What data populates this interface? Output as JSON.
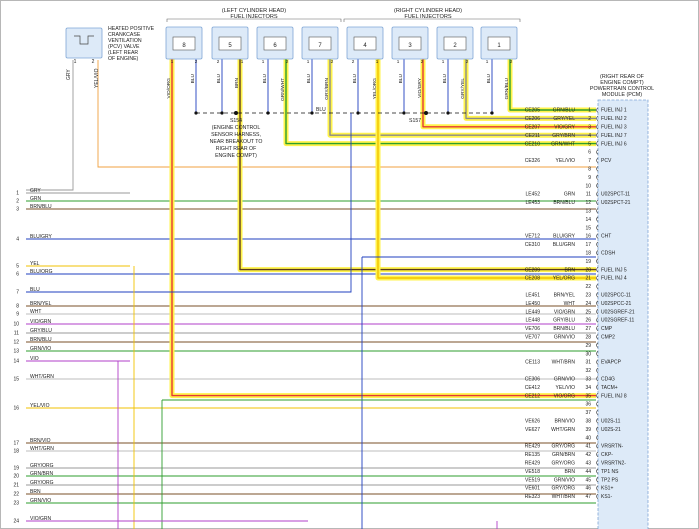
{
  "groups": {
    "left_head": [
      "(LEFT CYLINDER HEAD)",
      "FUEL INJECTORS"
    ],
    "right_head": [
      "(RIGHT CYLINDER HEAD)",
      "FUEL INJECTORS"
    ]
  },
  "pcv": {
    "label": [
      "HEATED POSITIVE",
      "CRANKCASE",
      "VENTILATION",
      "(PCV) VALVE",
      "(LEFT REAR",
      "OF ENGINE)"
    ],
    "pins": [
      "1",
      "2"
    ],
    "wires": [
      "GRY",
      "YEL/VIO"
    ]
  },
  "injectors": [
    {
      "num": "8",
      "wire": "VIO/ORG",
      "pin1": "1",
      "pin2": "2",
      "color": "#e53935"
    },
    {
      "num": "5",
      "wire": "BRN",
      "pin1": "2",
      "pin2": "1",
      "color": "#5c3a1e"
    },
    {
      "num": "6",
      "wire": "GRN/WHT",
      "pin1": "1",
      "pin2": "2",
      "color": "#2e9d2e"
    },
    {
      "num": "7",
      "wire": "GRY/BRN",
      "pin1": "1",
      "pin2": "2",
      "color": "#8a8a8a"
    },
    {
      "num": "4",
      "wire": "YEL/ORG",
      "pin1": "2",
      "pin2": "1",
      "color": "#f2c200"
    },
    {
      "num": "3",
      "wire": "VIO/GRY",
      "pin1": "1",
      "pin2": "2",
      "color": "#e53935"
    },
    {
      "num": "2",
      "wire": "GRY/YEL",
      "pin1": "1",
      "pin2": "2",
      "color": "#8a8a8a"
    },
    {
      "num": "1",
      "wire": "GRN/BLU",
      "pin1": "1",
      "pin2": "2",
      "color": "#2e9d2e"
    }
  ],
  "common_wire": "BLU",
  "splices": {
    "s154": {
      "id": "S154",
      "lines": [
        "(ENGINE CONTROL",
        "SENSOR HARNESS,",
        "NEAR BREAKOUT TO",
        "RIGHT REAR OF",
        "ENGINE COMPT)"
      ]
    },
    "s157": {
      "id": "S157"
    }
  },
  "pcm": {
    "title": [
      "(RIGHT REAR OF",
      "ENGINE COMPT)",
      "POWERTRAIN CONTROL",
      "MODULE (PCM)"
    ]
  },
  "pins": [
    {
      "pin": "1",
      "circuit": "CE205",
      "color": "GRN/BLU",
      "func": "FUEL INJ 1"
    },
    {
      "pin": "2",
      "circuit": "CE206",
      "color": "GRY/YEL",
      "func": "FUEL INJ 2"
    },
    {
      "pin": "3",
      "circuit": "CE207",
      "color": "VIO/GRY",
      "func": "FUEL INJ 3"
    },
    {
      "pin": "4",
      "circuit": "CE211",
      "color": "GRY/BRN",
      "func": "FUEL INJ 7"
    },
    {
      "pin": "5",
      "circuit": "CE210",
      "color": "GRN/WHT",
      "func": "FUEL INJ 6"
    },
    {
      "pin": "6",
      "circuit": "",
      "color": "",
      "func": ""
    },
    {
      "pin": "7",
      "circuit": "CE326",
      "color": "YEL/VIO",
      "func": "PCV"
    },
    {
      "pin": "8",
      "circuit": "",
      "color": "",
      "func": ""
    },
    {
      "pin": "9",
      "circuit": "",
      "color": "",
      "func": ""
    },
    {
      "pin": "10",
      "circuit": "",
      "color": "",
      "func": ""
    },
    {
      "pin": "11",
      "circuit": "LE452",
      "color": "GRN",
      "func": "U02SPCT-11"
    },
    {
      "pin": "12",
      "circuit": "LE453",
      "color": "BRN/BLU",
      "func": "U02SPCT-21"
    },
    {
      "pin": "13",
      "circuit": "",
      "color": "",
      "func": ""
    },
    {
      "pin": "14",
      "circuit": "",
      "color": "",
      "func": ""
    },
    {
      "pin": "15",
      "circuit": "",
      "color": "",
      "func": ""
    },
    {
      "pin": "16",
      "circuit": "VE712",
      "color": "BLU/GRY",
      "func": "CHT"
    },
    {
      "pin": "17",
      "circuit": "CE310",
      "color": "BLU/GRN",
      "func": ""
    },
    {
      "pin": "18",
      "circuit": "",
      "color": "",
      "func": "CDSH"
    },
    {
      "pin": "19",
      "circuit": "",
      "color": "",
      "func": ""
    },
    {
      "pin": "20",
      "circuit": "CE209",
      "color": "BRN",
      "func": "FUEL INJ 5"
    },
    {
      "pin": "21",
      "circuit": "CE208",
      "color": "YEL/ORG",
      "func": "FUEL INJ 4"
    },
    {
      "pin": "22",
      "circuit": "",
      "color": "",
      "func": ""
    },
    {
      "pin": "23",
      "circuit": "LE451",
      "color": "BRN/YEL",
      "func": "U02SPCC-11"
    },
    {
      "pin": "24",
      "circuit": "LE450",
      "color": "WHT",
      "func": "U02SPCC-21"
    },
    {
      "pin": "25",
      "circuit": "LE449",
      "color": "VIO/GRN",
      "func": "U02SGREF-21"
    },
    {
      "pin": "26",
      "circuit": "LE448",
      "color": "GRY/BLU",
      "func": "U02SGREF-11"
    },
    {
      "pin": "27",
      "circuit": "VE706",
      "color": "BRN/BLU",
      "func": "CMP"
    },
    {
      "pin": "28",
      "circuit": "VE707",
      "color": "GRN/VIO",
      "func": "CMP2"
    },
    {
      "pin": "29",
      "circuit": "",
      "color": "",
      "func": ""
    },
    {
      "pin": "30",
      "circuit": "",
      "color": "",
      "func": ""
    },
    {
      "pin": "31",
      "circuit": "CE113",
      "color": "WHT/BRN",
      "func": "EVAPCP"
    },
    {
      "pin": "32",
      "circuit": "",
      "color": "",
      "func": ""
    },
    {
      "pin": "33",
      "circuit": "CE306",
      "color": "GRN/VIO",
      "func": "CD4G"
    },
    {
      "pin": "34",
      "circuit": "CE412",
      "color": "YEL/VIO",
      "func": "TACM+"
    },
    {
      "pin": "35",
      "circuit": "CE212",
      "color": "VIO/ORG",
      "func": "FUEL INJ 8"
    },
    {
      "pin": "36",
      "circuit": "",
      "color": "",
      "func": ""
    },
    {
      "pin": "37",
      "circuit": "",
      "color": "",
      "func": ""
    },
    {
      "pin": "38",
      "circuit": "VE626",
      "color": "BRN/VIO",
      "func": "U02S-11"
    },
    {
      "pin": "39",
      "circuit": "VE627",
      "color": "WHT/GRN",
      "func": "U02S-21"
    },
    {
      "pin": "40",
      "circuit": "",
      "color": "",
      "func": ""
    },
    {
      "pin": "41",
      "circuit": "RE429",
      "color": "GRY/ORG",
      "func": "VRSRTN-"
    },
    {
      "pin": "42",
      "circuit": "RE135",
      "color": "GRN/BRN",
      "func": "CKP-"
    },
    {
      "pin": "43",
      "circuit": "RE429",
      "color": "GRY/ORG",
      "func": "VRSRTN2-"
    },
    {
      "pin": "44",
      "circuit": "VE518",
      "color": "BRN",
      "func": "TP1 NS"
    },
    {
      "pin": "45",
      "circuit": "VE519",
      "color": "GRN/VIO",
      "func": "TP2 PS"
    },
    {
      "pin": "46",
      "circuit": "VE601",
      "color": "GRY/ORG",
      "func": "KS1+"
    },
    {
      "pin": "47",
      "circuit": "RE323",
      "color": "WHT/BRN",
      "func": "KS1-"
    }
  ],
  "left_wires": [
    {
      "num": "1",
      "color": "GRY"
    },
    {
      "num": "2",
      "color": "GRN"
    },
    {
      "num": "3",
      "color": "BRN/BLU"
    },
    {
      "num": "4",
      "color": "BLU/GRY"
    },
    {
      "num": "5",
      "color": "YEL"
    },
    {
      "num": "6",
      "color": "BLU/ORG"
    },
    {
      "num": "7",
      "color": "BLU"
    },
    {
      "num": "8",
      "color": "BRN/YEL"
    },
    {
      "num": "9",
      "color": "WHT"
    },
    {
      "num": "10",
      "color": "VIO/GRN"
    },
    {
      "num": "11",
      "color": "GRY/BLU"
    },
    {
      "num": "12",
      "color": "BRN/BLU"
    },
    {
      "num": "13",
      "color": "GRN/VIO"
    },
    {
      "num": "14",
      "color": "VIO"
    },
    {
      "num": "15",
      "color": "WHT/GRN"
    },
    {
      "num": "16",
      "color": "YEL/VIO"
    },
    {
      "num": "17",
      "color": "BRN/VIO"
    },
    {
      "num": "18",
      "color": "WHT/GRN"
    },
    {
      "num": "19",
      "color": "GRY/ORG"
    },
    {
      "num": "20",
      "color": "GRN/BRN"
    },
    {
      "num": "21",
      "color": "GRY/ORG"
    },
    {
      "num": "22",
      "color": "BRN"
    },
    {
      "num": "23",
      "color": "GRN/VIO"
    },
    {
      "num": "24",
      "color": "VIO/GRN"
    }
  ]
}
